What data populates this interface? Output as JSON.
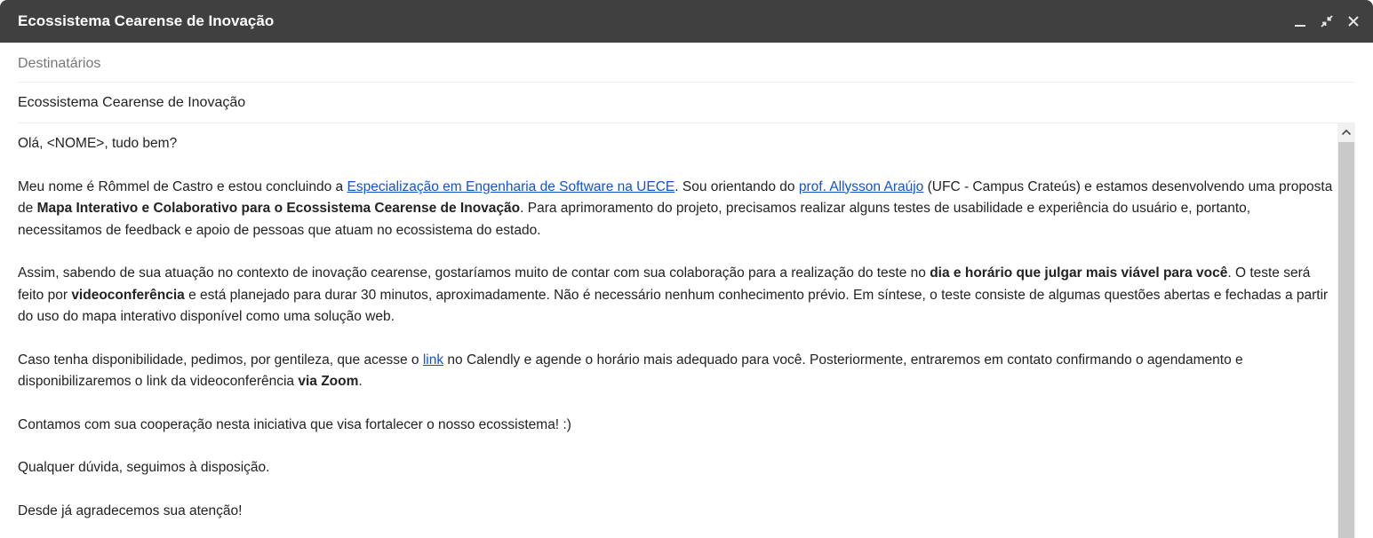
{
  "window": {
    "title": "Ecossistema Cearense de Inovação",
    "controls": [
      "minimize-icon",
      "exit-fullscreen-icon",
      "close-icon"
    ]
  },
  "compose": {
    "recipients_placeholder": "Destinatários",
    "subject": "Ecossistema Cearense de Inovação"
  },
  "message": {
    "greeting": "Olá, <NOME>, tudo bem?",
    "p1_a": "Meu nome é Rômmel de Castro e estou concluindo a ",
    "p1_link1": "Especialização em Engenharia de Software na UECE",
    "p1_b": ". Sou orientando do ",
    "p1_link2": "prof. Allysson Araújo",
    "p1_c": " (UFC - Campus Crateús) e estamos desenvolvendo uma proposta de ",
    "p1_bold": "Mapa Interativo e Colaborativo para o Ecossistema Cearense de Inovação",
    "p1_d": ". Para aprimoramento do projeto, precisamos realizar alguns testes de usabilidade e experiência do usuário e, portanto, necessitamos de feedback e apoio de pessoas que atuam no ecossistema do estado.",
    "p2_a": "Assim, sabendo de sua atuação no contexto de inovação cearense, gostaríamos muito de contar com sua colaboração para a realização do teste no ",
    "p2_bold1": "dia e horário que julgar mais viável para você",
    "p2_b": ". O teste será feito por ",
    "p2_bold2": "videoconferência",
    "p2_c": " e está planejado para durar 30 minutos, aproximadamente. Não é necessário nenhum conhecimento prévio. Em síntese, o teste consiste de algumas questões abertas e fechadas a partir do uso do mapa interativo disponível como uma solução web.",
    "p3_a": "Caso tenha disponibilidade, pedimos, por gentileza, que acesse o ",
    "p3_link": "link",
    "p3_b": " no Calendly e agende o horário mais adequado para você. Posteriormente, entraremos em contato confirmando o agendamento e disponibilizaremos o link da videoconferência ",
    "p3_bold": "via Zoom",
    "p3_c": ".",
    "p4": "Contamos com sua cooperação nesta iniciativa que visa fortalecer o nosso ecossistema! :)",
    "p5": "Qualquer dúvida, seguimos à disposição.",
    "p6": "Desde já agradecemos sua atenção!"
  },
  "colors": {
    "titlebar": "#404040",
    "link": "#1155cc",
    "scroll_thumb": "#c9c9c9"
  }
}
